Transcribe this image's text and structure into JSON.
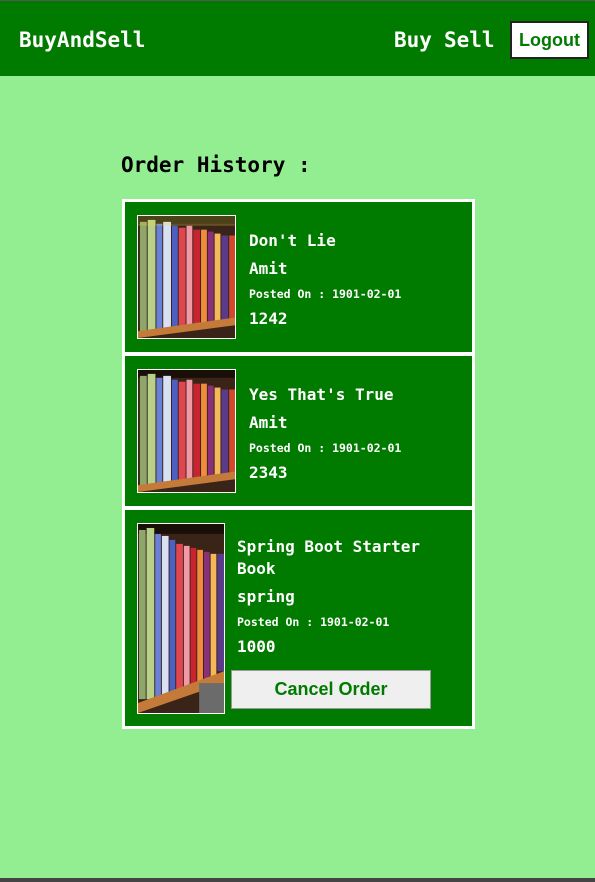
{
  "navbar": {
    "brand": "BuyAndSell",
    "links": [
      "Buy",
      "Sell"
    ],
    "logout_label": "Logout"
  },
  "page": {
    "title": "Order History :"
  },
  "orders": [
    {
      "title": "Don't Lie",
      "author": "Amit",
      "posted": "Posted On : 1901-02-01",
      "price": "1242",
      "image_icon": "books-on-shelf-icon"
    },
    {
      "title": "Yes That's True",
      "author": "Amit",
      "posted": "Posted On : 1901-02-01",
      "price": "2343",
      "image_icon": "books-on-shelf-icon"
    },
    {
      "title": "Spring Boot Starter Book",
      "author": "spring",
      "posted": "Posted On : 1901-02-01",
      "price": "1000",
      "image_icon": "books-on-shelf-icon",
      "action_label": "Cancel Order"
    }
  ],
  "colors": {
    "nav_green": "#007b00",
    "page_background": "#93ee91",
    "card_green": "#007b00"
  }
}
